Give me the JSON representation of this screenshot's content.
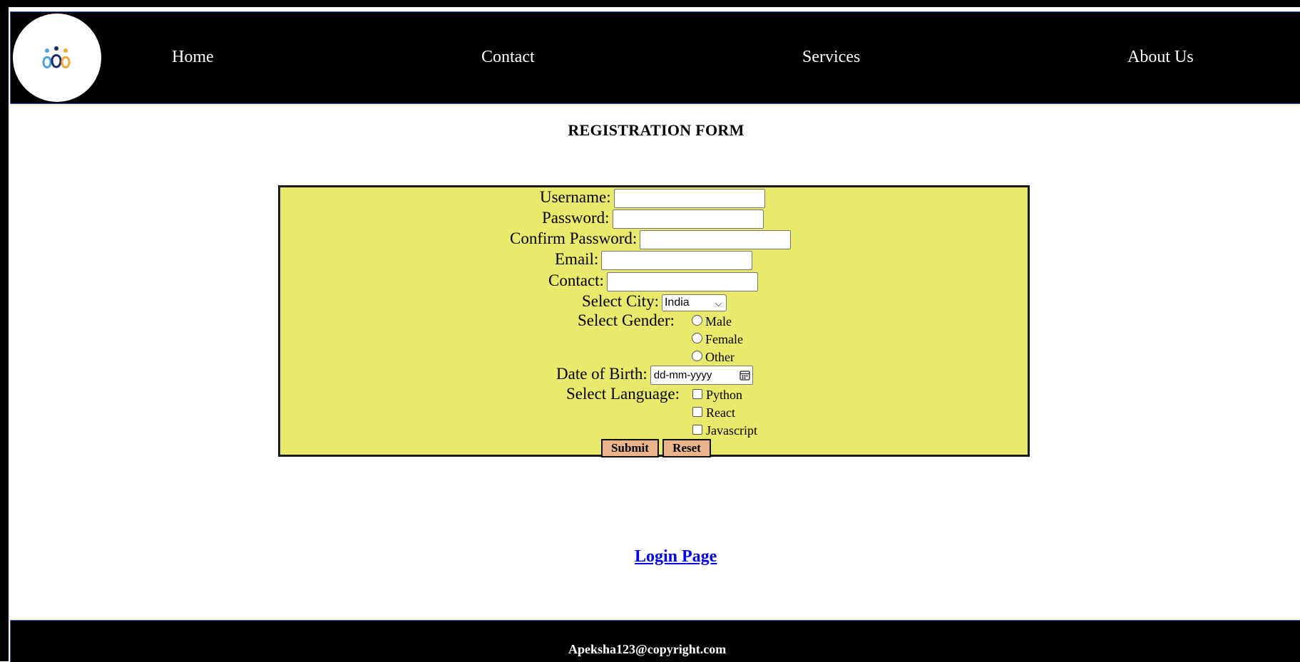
{
  "nav": {
    "items": [
      "Home",
      "Contact",
      "Services",
      "About Us"
    ]
  },
  "page": {
    "title": "REGISTRATION FORM"
  },
  "form": {
    "username_label": "Username:",
    "password_label": "Password:",
    "confirm_password_label": "Confirm Password:",
    "email_label": "Email:",
    "contact_label": "Contact:",
    "city_label": "Select City:",
    "city_selected": "India",
    "gender_label": "Select Gender:",
    "gender_options": [
      "Male",
      "Female",
      "Other"
    ],
    "dob_label": "Date of Birth:",
    "dob_placeholder": "dd-mm-yyyy",
    "language_label": "Select Language:",
    "language_options": [
      "Python",
      "React",
      "Javascript"
    ],
    "submit_label": "Submit",
    "reset_label": "Reset"
  },
  "links": {
    "login": "Login Page"
  },
  "footer": {
    "text": "Apeksha123@copyright.com"
  },
  "colors": {
    "header_bg": "#000000",
    "form_bg": "#e7ea6a",
    "button_bg": "#e9b48a",
    "link": "#0000ee"
  },
  "icons": {
    "logo": "people-logo-icon",
    "calendar": "calendar-icon",
    "dropdown": "chevron-down-icon"
  }
}
